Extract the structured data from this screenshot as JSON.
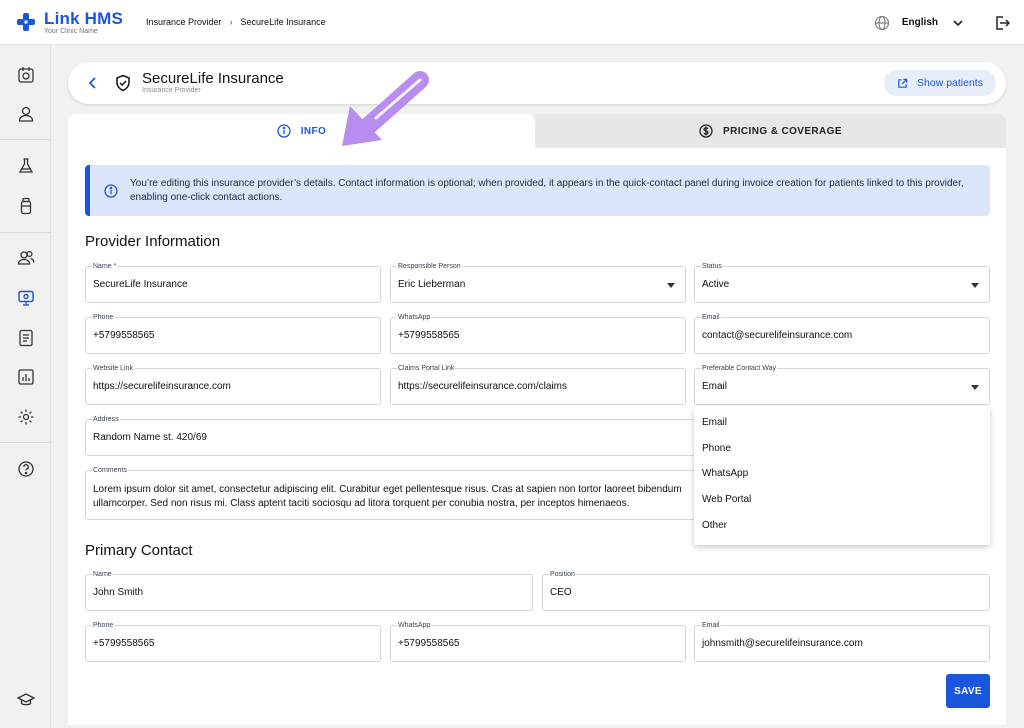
{
  "app": {
    "name": "Link HMS",
    "subtitle": "Your Clinic Name"
  },
  "breadcrumb": [
    "Insurance Provider",
    "SecureLife Insurance"
  ],
  "topbar": {
    "language": "English"
  },
  "header": {
    "title": "SecureLife Insurance",
    "subtitle": "Insurance Provider",
    "show_patients": "Show patients"
  },
  "tabs": [
    {
      "label": "INFO"
    },
    {
      "label": "PRICING & COVERAGE"
    }
  ],
  "banner": {
    "text": "You’re editing this insurance provider’s details. Contact information is optional; when provided, it appears in the quick-contact panel during invoice creation for patients linked to this provider, enabling one-click contact actions."
  },
  "provider": {
    "title": "Provider Information",
    "name": {
      "label": "Name *",
      "value": "SecureLife Insurance"
    },
    "responsible": {
      "label": "Responsible Person",
      "value": "Eric Lieberman"
    },
    "status": {
      "label": "Status",
      "value": "Active"
    },
    "phone": {
      "label": "Phone",
      "value": "+5799558565"
    },
    "whatsapp": {
      "label": "WhatsApp",
      "value": "+5799558565"
    },
    "email": {
      "label": "Email",
      "value": "contact@securelifeinsurance.com"
    },
    "website": {
      "label": "Website Link",
      "value": "https://securelifeinsurance.com"
    },
    "claims": {
      "label": "Claims Portal Link",
      "value": "https://securelifeinsurance.com/claims"
    },
    "contact_way": {
      "label": "Preferable Contact Way",
      "value": "Email",
      "options": [
        "Email",
        "Phone",
        "WhatsApp",
        "Web Portal",
        "Other"
      ]
    },
    "address": {
      "label": "Address",
      "value": "Random Name st. 420/69"
    },
    "comments": {
      "label": "Comments",
      "value": "Lorem ipsum dolor sit amet, consectetur adipiscing elit. Curabitur eget pellentesque risus. Cras at sapien non tortor laoreet bibendum ullamcorper. Sed non risus mi. Class aptent taciti sociosqu ad litora torquent per conubia nostra, per inceptos himenaeos."
    }
  },
  "contact": {
    "title": "Primary Contact",
    "name": {
      "label": "Name",
      "value": "John Smith"
    },
    "position": {
      "label": "Position",
      "value": "CEO"
    },
    "phone": {
      "label": "Phone",
      "value": "+5799558565"
    },
    "whatsapp": {
      "label": "WhatsApp",
      "value": "+5799558565"
    },
    "email": {
      "label": "Email",
      "value": "johnsmith@securelifeinsurance.com"
    }
  },
  "save_label": "SAVE",
  "colors": {
    "accent": "#1a56db",
    "banner_bg": "#dbe6fb",
    "annotation": "#b98cf0"
  },
  "icons": [
    "plus-logo-icon",
    "globe-icon",
    "chevron-down-icon",
    "logout-icon",
    "calendar-icon",
    "user-icon",
    "flask-icon",
    "bottle-icon",
    "users-icon",
    "monitor-icon",
    "report-icon",
    "chart-icon",
    "gear-icon",
    "help-icon",
    "graduation-cap-icon",
    "back-arrow-icon",
    "shield-check-icon",
    "external-link-icon",
    "info-icon",
    "dollar-circle-icon"
  ]
}
